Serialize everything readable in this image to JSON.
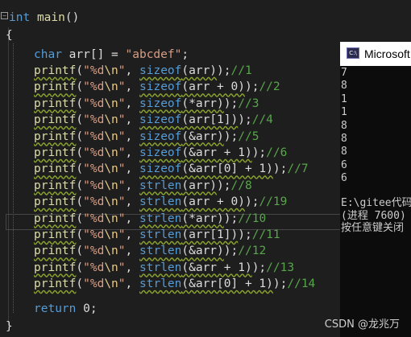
{
  "code": {
    "line1": {
      "kw": "int",
      "fn": "main",
      "paren": "()"
    },
    "brace_open": "{",
    "brace_close": "}",
    "decl": {
      "type": "char",
      "var": "arr[]",
      "eq": " = ",
      "str": "\"abcdef\"",
      "semi": ";"
    },
    "lines": [
      {
        "fn": "printf",
        "open": "(",
        "fmt_a": "\"%d",
        "esc": "\\n",
        "fmt_b": "\"",
        "comma": ", ",
        "call": "sizeof",
        "arg": "(arr)",
        "close": ");",
        "cmt": "//1"
      },
      {
        "fn": "printf",
        "open": "(",
        "fmt_a": "\"%d",
        "esc": "\\n",
        "fmt_b": "\"",
        "comma": ", ",
        "call": "sizeof",
        "arg": "(arr + 0)",
        "close": ");",
        "cmt": "//2"
      },
      {
        "fn": "printf",
        "open": "(",
        "fmt_a": "\"%d",
        "esc": "\\n",
        "fmt_b": "\"",
        "comma": ", ",
        "call": "sizeof",
        "arg": "(*arr)",
        "close": ");",
        "cmt": "//3"
      },
      {
        "fn": "printf",
        "open": "(",
        "fmt_a": "\"%d",
        "esc": "\\n",
        "fmt_b": "\"",
        "comma": ", ",
        "call": "sizeof",
        "arg": "(arr[1])",
        "close": ");",
        "cmt": "//4"
      },
      {
        "fn": "printf",
        "open": "(",
        "fmt_a": "\"%d",
        "esc": "\\n",
        "fmt_b": "\"",
        "comma": ", ",
        "call": "sizeof",
        "arg": "(&arr)",
        "close": ");",
        "cmt": "//5"
      },
      {
        "fn": "printf",
        "open": "(",
        "fmt_a": "\"%d",
        "esc": "\\n",
        "fmt_b": "\"",
        "comma": ", ",
        "call": "sizeof",
        "arg": "(&arr + 1)",
        "close": ");",
        "cmt": "//6"
      },
      {
        "fn": "printf",
        "open": "(",
        "fmt_a": "\"%d",
        "esc": "\\n",
        "fmt_b": "\"",
        "comma": ", ",
        "call": "sizeof",
        "arg": "(&arr[0] + 1)",
        "close": ");",
        "cmt": "//7"
      },
      {
        "fn": "printf",
        "open": "(",
        "fmt_a": "\"%d",
        "esc": "\\n",
        "fmt_b": "\"",
        "comma": ", ",
        "call": "strlen",
        "arg": "(arr)",
        "close": ");",
        "cmt": "//8"
      },
      {
        "fn": "printf",
        "open": "(",
        "fmt_a": "\"%d",
        "esc": "\\n",
        "fmt_b": "\"",
        "comma": ", ",
        "call": "strlen",
        "arg": "(arr + 0)",
        "close": ");",
        "cmt": "//19"
      },
      {
        "fn": "printf",
        "open": "(",
        "fmt_a": "\"%d",
        "esc": "\\n",
        "fmt_b": "\"",
        "comma": ", ",
        "call": "strlen",
        "arg": "(*arr)",
        "close": ");",
        "cmt": "//10"
      },
      {
        "fn": "printf",
        "open": "(",
        "fmt_a": "\"%d",
        "esc": "\\n",
        "fmt_b": "\"",
        "comma": ", ",
        "call": "strlen",
        "arg": "(arr[1])",
        "close": ");",
        "cmt": "//11"
      },
      {
        "fn": "printf",
        "open": "(",
        "fmt_a": "\"%d",
        "esc": "\\n",
        "fmt_b": "\"",
        "comma": ", ",
        "call": "strlen",
        "arg": "(&arr)",
        "close": ");",
        "cmt": "//12"
      },
      {
        "fn": "printf",
        "open": "(",
        "fmt_a": "\"%d",
        "esc": "\\n",
        "fmt_b": "\"",
        "comma": ", ",
        "call": "strlen",
        "arg": "(&arr + 1)",
        "close": ");",
        "cmt": "//13"
      },
      {
        "fn": "printf",
        "open": "(",
        "fmt_a": "\"%d",
        "esc": "\\n",
        "fmt_b": "\"",
        "comma": ", ",
        "call": "strlen",
        "arg": "(&arr[0] + 1)",
        "close": ");",
        "cmt": "//14"
      }
    ],
    "ret": {
      "kw": "return",
      "val": " 0;"
    }
  },
  "console": {
    "title": "Microsoft",
    "icon_label": "C:\\",
    "output": [
      "7",
      "8",
      "1",
      "1",
      "8",
      "8",
      "8",
      "6",
      "6"
    ],
    "path": "E:\\gitee代码",
    "process": "(进程 7600)",
    "prompt": "按任意键关闭"
  },
  "watermark": "CSDN @龙兆万",
  "colors": {
    "editor_bg": "#1e1e1e",
    "keyword": "#569cd6",
    "string": "#d69d85",
    "function": "#dcdcaa",
    "comment": "#57a64a",
    "console_bg": "#0c0c0c"
  }
}
